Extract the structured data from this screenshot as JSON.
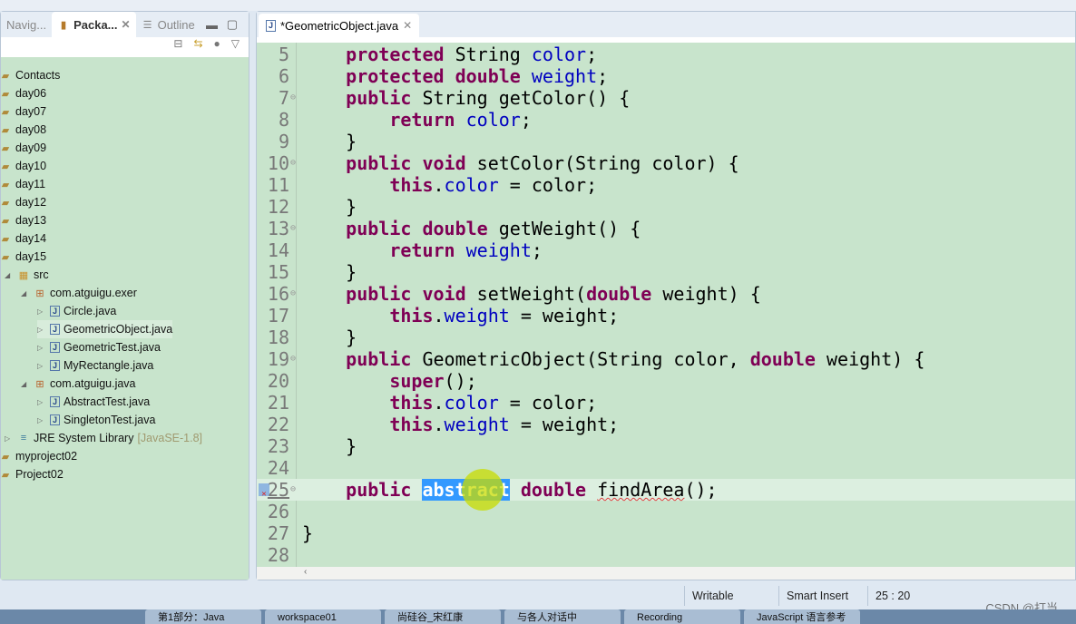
{
  "left_panel": {
    "tabs": [
      {
        "label": "Navig..."
      },
      {
        "label": "Packa...",
        "active": true
      },
      {
        "label": "Outline"
      }
    ],
    "tree": [
      {
        "label": "Contacts",
        "level": 0,
        "icon": "project-icon"
      },
      {
        "label": "day06",
        "level": 0,
        "icon": "project-icon"
      },
      {
        "label": "day07",
        "level": 0,
        "icon": "project-icon"
      },
      {
        "label": "day08",
        "level": 0,
        "icon": "project-icon"
      },
      {
        "label": "day09",
        "level": 0,
        "icon": "project-icon"
      },
      {
        "label": "day10",
        "level": 0,
        "icon": "project-icon"
      },
      {
        "label": "day11",
        "level": 0,
        "icon": "project-icon"
      },
      {
        "label": "day12",
        "level": 0,
        "icon": "project-icon"
      },
      {
        "label": "day13",
        "level": 0,
        "icon": "project-icon"
      },
      {
        "label": "day14",
        "level": 0,
        "icon": "project-icon"
      },
      {
        "label": "day15",
        "level": 0,
        "icon": "project-icon"
      },
      {
        "label": "src",
        "level": 1,
        "icon": "source-folder-icon",
        "expanded": true
      },
      {
        "label": "com.atguigu.exer",
        "level": 2,
        "icon": "package-icon",
        "expanded": true
      },
      {
        "label": "Circle.java",
        "level": 3,
        "icon": "java-file-icon",
        "expanded": false
      },
      {
        "label": "GeometricObject.java",
        "level": 3,
        "icon": "java-file-icon",
        "expanded": false,
        "selected": true
      },
      {
        "label": "GeometricTest.java",
        "level": 3,
        "icon": "java-file-icon",
        "expanded": false
      },
      {
        "label": "MyRectangle.java",
        "level": 3,
        "icon": "java-file-icon",
        "expanded": false
      },
      {
        "label": "com.atguigu.java",
        "level": 2,
        "icon": "package-icon",
        "expanded": true
      },
      {
        "label": "AbstractTest.java",
        "level": 3,
        "icon": "java-file-icon",
        "expanded": false
      },
      {
        "label": "SingletonTest.java",
        "level": 3,
        "icon": "java-file-icon",
        "expanded": false
      },
      {
        "label": "JRE System Library",
        "decoration": "[JavaSE-1.8]",
        "level": 1,
        "icon": "library-icon",
        "expanded": false
      },
      {
        "label": "myproject02",
        "level": 0,
        "icon": "project-icon"
      },
      {
        "label": "Project02",
        "level": 0,
        "icon": "project-icon"
      }
    ]
  },
  "editor": {
    "tab_label": "*GeometricObject.java",
    "current_line": 25,
    "lines": [
      {
        "n": "5",
        "t": [
          [
            "p",
            "    "
          ],
          [
            "kw",
            "protected"
          ],
          [
            "p",
            " String "
          ],
          [
            "fld",
            "color"
          ],
          [
            "p",
            ";"
          ]
        ]
      },
      {
        "n": "6",
        "t": [
          [
            "p",
            "    "
          ],
          [
            "kw",
            "protected"
          ],
          [
            "p",
            " "
          ],
          [
            "kw",
            "double"
          ],
          [
            "p",
            " "
          ],
          [
            "fld",
            "weight"
          ],
          [
            "p",
            ";"
          ]
        ]
      },
      {
        "n": "7",
        "fold": true,
        "t": [
          [
            "p",
            "    "
          ],
          [
            "kw",
            "public"
          ],
          [
            "p",
            " String getColor() {"
          ]
        ]
      },
      {
        "n": "8",
        "t": [
          [
            "p",
            "        "
          ],
          [
            "kw",
            "return"
          ],
          [
            "p",
            " "
          ],
          [
            "fld",
            "color"
          ],
          [
            "p",
            ";"
          ]
        ]
      },
      {
        "n": "9",
        "t": [
          [
            "p",
            "    }"
          ]
        ]
      },
      {
        "n": "10",
        "fold": true,
        "t": [
          [
            "p",
            "    "
          ],
          [
            "kw",
            "public"
          ],
          [
            "p",
            " "
          ],
          [
            "kw",
            "void"
          ],
          [
            "p",
            " setColor(String color) {"
          ]
        ]
      },
      {
        "n": "11",
        "t": [
          [
            "p",
            "        "
          ],
          [
            "kw",
            "this"
          ],
          [
            "p",
            "."
          ],
          [
            "fld",
            "color"
          ],
          [
            "p",
            " = color;"
          ]
        ]
      },
      {
        "n": "12",
        "t": [
          [
            "p",
            "    }"
          ]
        ]
      },
      {
        "n": "13",
        "fold": true,
        "t": [
          [
            "p",
            "    "
          ],
          [
            "kw",
            "public"
          ],
          [
            "p",
            " "
          ],
          [
            "kw",
            "double"
          ],
          [
            "p",
            " getWeight() {"
          ]
        ]
      },
      {
        "n": "14",
        "t": [
          [
            "p",
            "        "
          ],
          [
            "kw",
            "return"
          ],
          [
            "p",
            " "
          ],
          [
            "fld",
            "weight"
          ],
          [
            "p",
            ";"
          ]
        ]
      },
      {
        "n": "15",
        "t": [
          [
            "p",
            "    }"
          ]
        ]
      },
      {
        "n": "16",
        "fold": true,
        "t": [
          [
            "p",
            "    "
          ],
          [
            "kw",
            "public"
          ],
          [
            "p",
            " "
          ],
          [
            "kw",
            "void"
          ],
          [
            "p",
            " setWeight("
          ],
          [
            "kw",
            "double"
          ],
          [
            "p",
            " weight) {"
          ]
        ]
      },
      {
        "n": "17",
        "t": [
          [
            "p",
            "        "
          ],
          [
            "kw",
            "this"
          ],
          [
            "p",
            "."
          ],
          [
            "fld",
            "weight"
          ],
          [
            "p",
            " = weight;"
          ]
        ]
      },
      {
        "n": "18",
        "t": [
          [
            "p",
            "    }"
          ]
        ]
      },
      {
        "n": "19",
        "fold": true,
        "t": [
          [
            "p",
            "    "
          ],
          [
            "kw",
            "public"
          ],
          [
            "p",
            " GeometricObject(String color, "
          ],
          [
            "kw",
            "double"
          ],
          [
            "p",
            " weight) {"
          ]
        ]
      },
      {
        "n": "20",
        "t": [
          [
            "p",
            "        "
          ],
          [
            "kw",
            "super"
          ],
          [
            "p",
            "();"
          ]
        ]
      },
      {
        "n": "21",
        "t": [
          [
            "p",
            "        "
          ],
          [
            "kw",
            "this"
          ],
          [
            "p",
            "."
          ],
          [
            "fld",
            "color"
          ],
          [
            "p",
            " = color;"
          ]
        ]
      },
      {
        "n": "22",
        "t": [
          [
            "p",
            "        "
          ],
          [
            "kw",
            "this"
          ],
          [
            "p",
            "."
          ],
          [
            "fld",
            "weight"
          ],
          [
            "p",
            " = weight;"
          ]
        ]
      },
      {
        "n": "23",
        "t": [
          [
            "p",
            "    }"
          ]
        ]
      },
      {
        "n": "24",
        "t": []
      },
      {
        "n": "25",
        "fold": true,
        "error": true,
        "t": [
          [
            "p",
            "    "
          ],
          [
            "kw",
            "public"
          ],
          [
            "p",
            " "
          ],
          [
            "sel",
            "abstract"
          ],
          [
            "p",
            " "
          ],
          [
            "kw",
            "double"
          ],
          [
            "p",
            " "
          ],
          [
            "squig",
            "findArea"
          ],
          [
            "p",
            "();"
          ]
        ]
      },
      {
        "n": "26",
        "t": []
      },
      {
        "n": "27",
        "t": [
          [
            "p",
            "}"
          ]
        ]
      },
      {
        "n": "28",
        "t": []
      }
    ]
  },
  "status": {
    "writable": "Writable",
    "insert_mode": "Smart Insert",
    "position": "25 : 20"
  },
  "taskbar": [
    "第1部分：Java",
    "workspace01",
    "尚硅谷_宋红康",
    "与各人对话中",
    "Recording",
    "JavaScript 语言参考"
  ],
  "watermark": "CSDN @打当",
  "colors": {
    "editor_bg": "#c8e4cc",
    "keyword": "#7f0055",
    "field": "#0000c0",
    "selection": "#3399ff"
  }
}
